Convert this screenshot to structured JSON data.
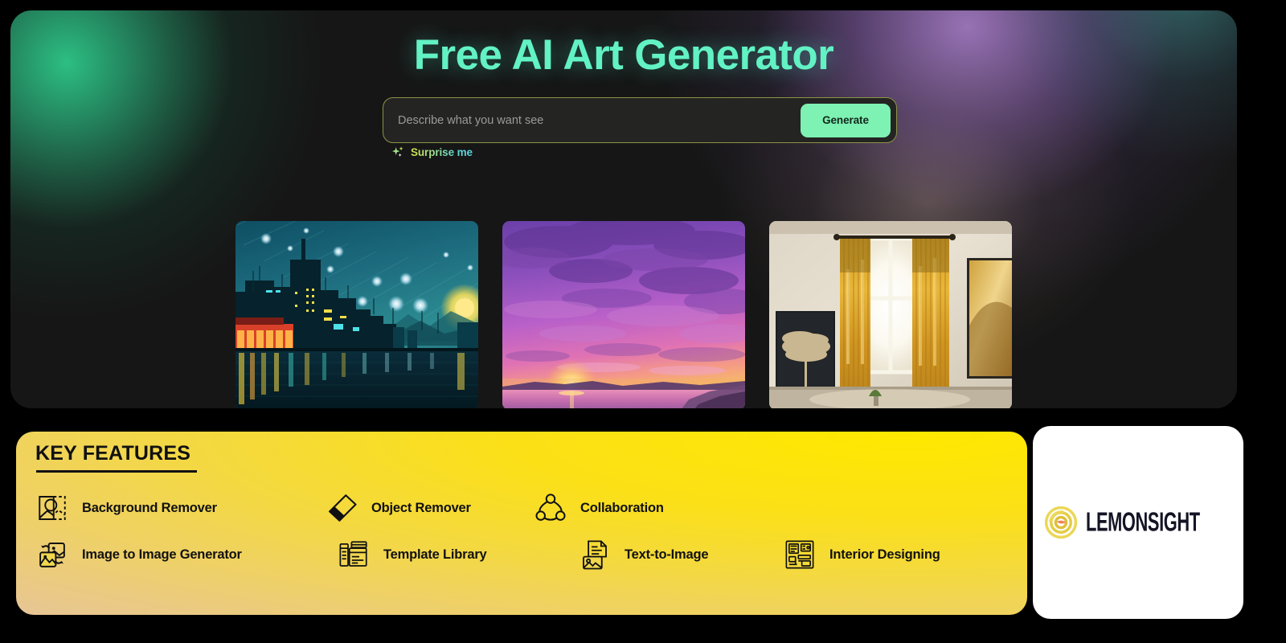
{
  "hero": {
    "title": "Free AI Art Generator",
    "prompt": {
      "placeholder": "Describe what you want see",
      "value": "",
      "generate_label": "Generate"
    },
    "surprise_label": "Surprise me",
    "accent_green": "#62F2C4",
    "accent_button": "#7DF2B2",
    "panel_bg": "#161616",
    "input_border": "#8c9444"
  },
  "gallery": {
    "items": [
      {
        "name": "starry-night-cityscape",
        "alt": "Van Gogh style starry night city waterfront with glowing lights reflected in water"
      },
      {
        "name": "purple-sunset-seascape",
        "alt": "Purple and pink cloudy sunset over a lake with distant hills"
      },
      {
        "name": "interior-room-golden-curtains",
        "alt": "Interior room with golden curtains, bright window, framed plant artwork"
      }
    ]
  },
  "features": {
    "title": "KEY FEATURES",
    "panel_color_top": "#FFE800",
    "panel_color_bottom": "#E3C2A4",
    "rows": [
      [
        {
          "icon": "background-remover-icon",
          "label": "Background Remover"
        },
        {
          "icon": "eraser-icon",
          "label": "Object Remover"
        },
        {
          "icon": "collaboration-icon",
          "label": "Collaboration"
        }
      ],
      [
        {
          "icon": "image-to-image-icon",
          "label": "Image to Image Generator"
        },
        {
          "icon": "template-library-icon",
          "label": "Template Library"
        },
        {
          "icon": "text-to-image-icon",
          "label": "Text-to-Image"
        },
        {
          "icon": "interior-design-icon",
          "label": "Interior Designing"
        }
      ]
    ]
  },
  "brand": {
    "name": "LEMONSIGHT",
    "mark": "lemon-swirl-icon",
    "mark_color": "#E8D24C",
    "text_color": "#141425"
  }
}
